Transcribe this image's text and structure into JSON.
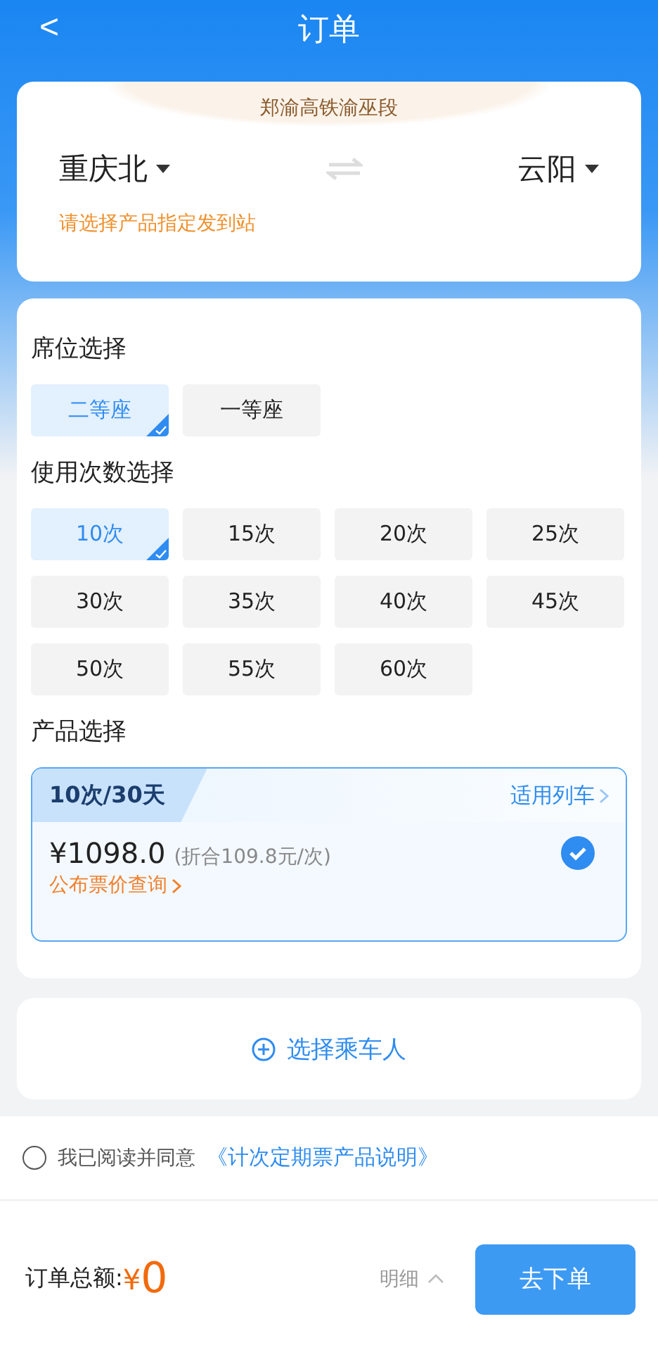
{
  "header": {
    "back": "<",
    "title": "订单"
  },
  "route": {
    "line": "郑渝高铁渝巫段",
    "from": "重庆北",
    "to": "云阳",
    "hint": "请选择产品指定发到站"
  },
  "seat": {
    "title": "席位选择",
    "options": [
      {
        "label": "二等座",
        "selected": true
      },
      {
        "label": "一等座",
        "selected": false
      }
    ]
  },
  "count": {
    "title": "使用次数选择",
    "options": [
      {
        "label": "10次",
        "selected": true
      },
      {
        "label": "15次",
        "selected": false
      },
      {
        "label": "20次",
        "selected": false
      },
      {
        "label": "25次",
        "selected": false
      },
      {
        "label": "30次",
        "selected": false
      },
      {
        "label": "35次",
        "selected": false
      },
      {
        "label": "40次",
        "selected": false
      },
      {
        "label": "45次",
        "selected": false
      },
      {
        "label": "50次",
        "selected": false
      },
      {
        "label": "55次",
        "selected": false
      },
      {
        "label": "60次",
        "selected": false
      }
    ]
  },
  "product": {
    "title": "产品选择",
    "items": [
      {
        "name": "10次/30天",
        "trains_link": "适用列车",
        "price": "¥1098.0",
        "per_ride": "(折合109.8元/次)",
        "fare_link": "公布票价查询",
        "selected": true
      }
    ]
  },
  "passenger": {
    "label": "选择乘车人"
  },
  "agreement": {
    "checked": false,
    "text": "我已阅读并同意",
    "link": "《计次定期票产品说明》"
  },
  "footer": {
    "total_label": "订单总额:",
    "currency": "¥",
    "total": "0",
    "detail": "明细",
    "submit": "去下单"
  }
}
